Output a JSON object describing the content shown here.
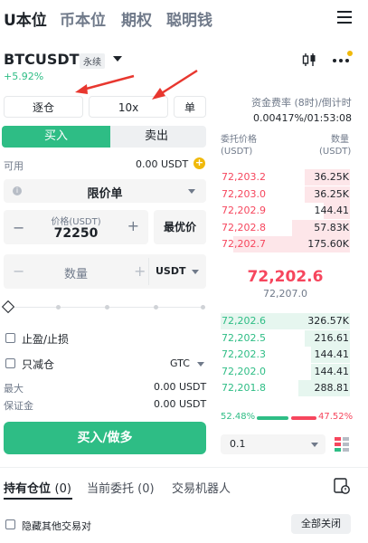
{
  "nav": {
    "tabs": [
      "U本位",
      "币本位",
      "期权",
      "聪明钱"
    ]
  },
  "symbol": {
    "name": "BTCUSDT",
    "badge": "永续",
    "change": "+5.92%"
  },
  "funding": {
    "label": "资金费率 (8时)/倒计时",
    "value": "0.00417%/01:53:08"
  },
  "margin": {
    "mode": "逐仓",
    "leverage": "10x",
    "mode2": "单"
  },
  "side": {
    "buy": "买入",
    "sell": "卖出"
  },
  "available": {
    "label": "可用",
    "value": "0.00 USDT"
  },
  "order_type": "限价单",
  "price": {
    "label": "价格(USDT)",
    "value": "72250",
    "best": "最优价"
  },
  "qty": {
    "placeholder": "数量",
    "unit": "USDT"
  },
  "options": {
    "tpsl": "止盈/止损",
    "reduce": "只减仓",
    "tif": "GTC"
  },
  "max": {
    "label": "最大",
    "value": "0.00 USDT"
  },
  "cost": {
    "label": "保证金",
    "value": "0.00 USDT"
  },
  "submit": "买入/做多",
  "book": {
    "h_price": "委托价格",
    "h_price_unit": "(USDT)",
    "h_qty": "数量",
    "h_qty_unit": "(USDT)",
    "asks": [
      {
        "p": "72,203.2",
        "q": "36.25K",
        "depth": 0.35
      },
      {
        "p": "72,203.0",
        "q": "36.25K",
        "depth": 0.35
      },
      {
        "p": "72,202.9",
        "q": "144.41",
        "depth": 0.2
      },
      {
        "p": "72,202.8",
        "q": "57.83K",
        "depth": 0.45
      },
      {
        "p": "72,202.7",
        "q": "175.60K",
        "depth": 0.9
      }
    ],
    "last": "72,202.6",
    "mark": "72,207.0",
    "bids": [
      {
        "p": "72,202.6",
        "q": "326.57K",
        "depth": 1.0
      },
      {
        "p": "72,202.5",
        "q": "216.61",
        "depth": 0.35
      },
      {
        "p": "72,202.3",
        "q": "144.41",
        "depth": 0.3
      },
      {
        "p": "72,202.0",
        "q": "144.41",
        "depth": 0.3
      },
      {
        "p": "72,201.8",
        "q": "288.81",
        "depth": 0.4
      }
    ],
    "buy_pct": "52.48%",
    "sell_pct": "47.52%",
    "buy_ratio": 0.5248,
    "step": "0.1"
  },
  "bottom": {
    "tabs": [
      "持有仓位",
      "当前委托",
      "交易机器人"
    ],
    "counts": [
      "(0)",
      "(0)"
    ],
    "hide_label": "隐藏其他交易对",
    "close_all": "全部关闭"
  },
  "colors": {
    "buy": "#2ebd85",
    "sell": "#f6465d",
    "annotation": "#e8372f"
  }
}
